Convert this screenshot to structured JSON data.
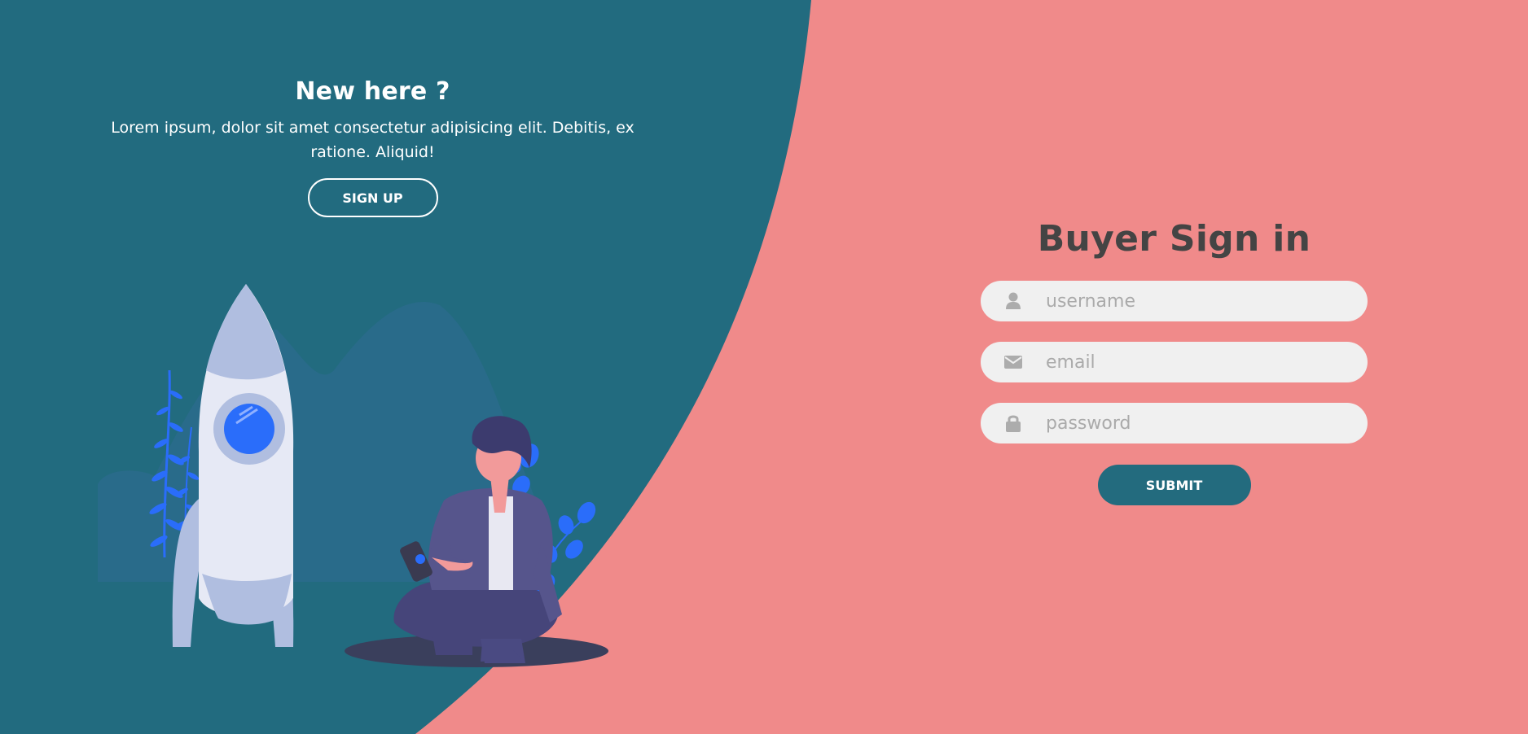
{
  "colors": {
    "left_panel": "#226b7f",
    "right_panel": "#f08a8a",
    "title_text": "#444444",
    "input_bg": "#f0f0f0",
    "submit_bg": "#236b7e",
    "accent_blue": "#2a6dfa"
  },
  "left_panel": {
    "title": "New here ?",
    "text": "Lorem ipsum, dolor sit amet consectetur adipisicing elit. Debitis, ex ratione. Aliquid!",
    "signup_label": "SIGN UP",
    "illustration_icon": "rocket-and-person-illustration"
  },
  "form": {
    "title": "Buyer Sign in",
    "username": {
      "placeholder": "username",
      "value": "",
      "icon": "user-icon"
    },
    "email": {
      "placeholder": "email",
      "value": "",
      "icon": "envelope-icon"
    },
    "password": {
      "placeholder": "password",
      "value": "",
      "icon": "lock-icon"
    },
    "submit_label": "SUBMIT"
  }
}
